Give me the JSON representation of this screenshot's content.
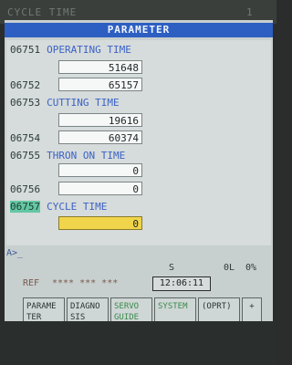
{
  "bezel": {
    "left_text": "CYCLE TIME",
    "right_text": "1"
  },
  "title": "PARAMETER",
  "params": [
    {
      "number": "06751",
      "name": "OPERATING TIME",
      "values": [
        "51648",
        "65157"
      ],
      "second_number": "06752",
      "highlighted": false
    },
    {
      "number": "06753",
      "name": "CUTTING TIME",
      "values": [
        "19616",
        "60374"
      ],
      "second_number": "06754",
      "highlighted": false
    },
    {
      "number": "06755",
      "name": "THRON ON TIME",
      "values": [
        "0",
        "0"
      ],
      "second_number": "06756",
      "highlighted": false
    },
    {
      "number": "06757",
      "name": "CYCLE TIME",
      "values": [
        "0"
      ],
      "second_number": "",
      "highlighted": true
    }
  ],
  "input_prompt": "A>_",
  "status": {
    "mode_s": "S",
    "left_value": "0L",
    "right_value": "0%"
  },
  "mode_bar": {
    "mode": "REF",
    "stars": "**** *** ***",
    "clock": "12:06:11"
  },
  "softkeys": [
    {
      "label": "PARAME\nTER",
      "current": true,
      "green": false
    },
    {
      "label": "DIAGNO\nSIS",
      "current": false,
      "green": false
    },
    {
      "label": "SERVO\nGUIDE",
      "current": false,
      "green": true
    },
    {
      "label": "SYSTEM",
      "current": false,
      "green": true
    },
    {
      "label": "(OPRT)",
      "current": false,
      "green": false
    },
    {
      "label": "+",
      "current": false,
      "green": false
    }
  ]
}
